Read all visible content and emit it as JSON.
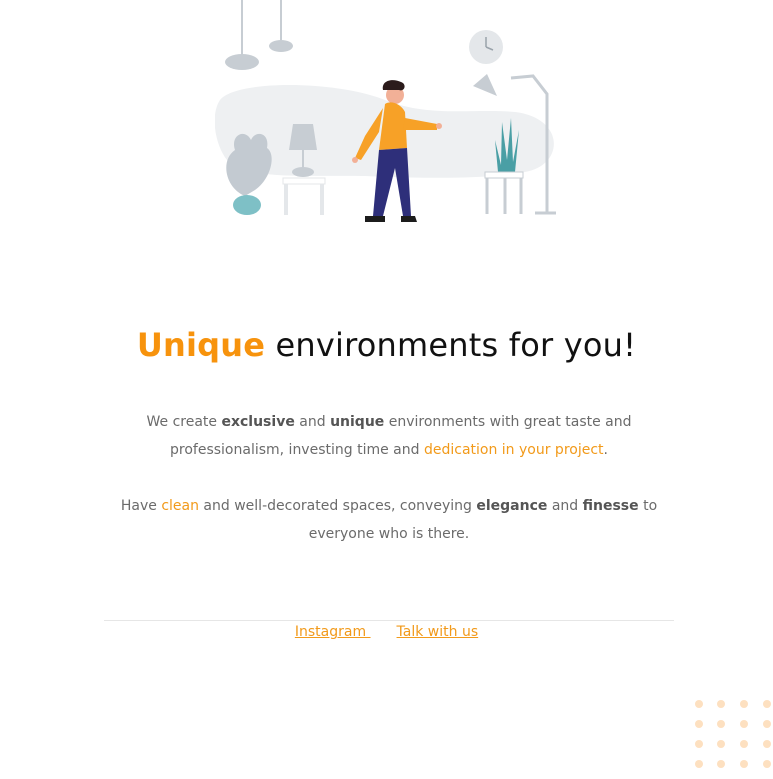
{
  "hero": {
    "illustration": "person-in-living-room-illustration",
    "title_accent": "Unique",
    "title_rest": " environments for you!"
  },
  "about": {
    "p1": {
      "t1": "We create ",
      "b1": "exclusive",
      "t2": " and ",
      "b2": "unique",
      "t3": " environments with great taste and professionalism, investing time and ",
      "hl1": "dedication in your project",
      "t4": "."
    },
    "p2": {
      "t1": "Have ",
      "hl1": "clean",
      "t2": " and well-decorated spaces, conveying ",
      "b1": "elegance",
      "t3": " and ",
      "b2": "finesse",
      "t4": " to everyone who is there."
    }
  },
  "footer": {
    "instagram_label": "Instagram ",
    "contact_label": "Talk with us"
  },
  "colors": {
    "accent": "#f7930d",
    "link": "#f29a1a",
    "text": "#6b6b6b",
    "heading": "#111111",
    "dots": "#fde0c0"
  }
}
